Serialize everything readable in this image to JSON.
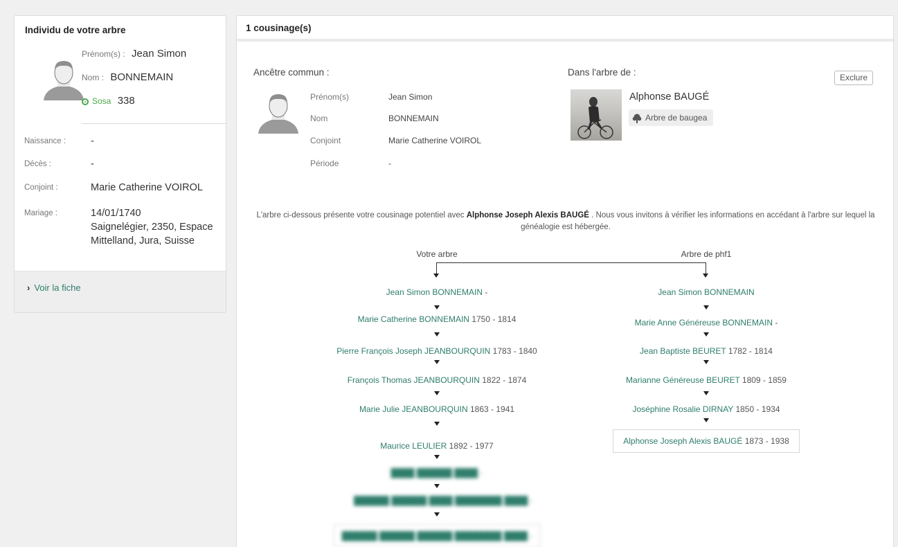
{
  "left": {
    "title": "Individu de votre arbre",
    "prenom_label": "Prénom(s) :",
    "prenom": "Jean Simon",
    "nom_label": "Nom :",
    "nom": "BONNEMAIN",
    "sosa_label": "Sosa",
    "sosa": "338",
    "naissance_label": "Naissance :",
    "naissance": "-",
    "deces_label": "Décès :",
    "deces": "-",
    "conjoint_label": "Conjoint :",
    "conjoint": "Marie Catherine VOIROL",
    "mariage_label": "Mariage :",
    "mariage_date": "14/01/1740",
    "mariage_lieu": "Saignelégier, 2350, Espace Mittelland, Jura, Suisse",
    "voir_fiche": "Voir la fiche"
  },
  "right": {
    "title": "1 cousinage(s)",
    "ancetre_label": "Ancêtre commun :",
    "ancetre": {
      "prenom_label": "Prénom(s)",
      "prenom": "Jean Simon",
      "nom_label": "Nom",
      "nom": "BONNEMAIN",
      "conjoint_label": "Conjoint",
      "conjoint": "Marie Catherine VOIROL",
      "periode_label": "Période",
      "periode": "-"
    },
    "dans_arbre_label": "Dans l'arbre de :",
    "exclure": "Exclure",
    "person_name": "Alphonse BAUGÉ",
    "tree_button": "Arbre de baugea",
    "intro_part1": "L'arbre ci-dessous présente votre cousinage potentiel avec ",
    "intro_bold": "Alphonse Joseph Alexis BAUGÉ",
    "intro_part2": " . Nous vous invitons à vérifier les informations en accédant à l'arbre sur lequel la généalogie est hébergée.",
    "col_left_head": "Votre arbre",
    "col_right_head": "Arbre de phf1",
    "left_chain": [
      {
        "name": "Jean Simon BONNEMAIN",
        "dates": "-"
      },
      {
        "name": "Marie Catherine BONNEMAIN",
        "dates": "1750 - 1814"
      },
      {
        "name": "Pierre François Joseph JEANBOURQUIN",
        "dates": "1783 - 1840"
      },
      {
        "name": "François Thomas JEANBOURQUIN",
        "dates": "1822 - 1874"
      },
      {
        "name": "Marie Julie JEANBOURQUIN",
        "dates": "1863 - 1941"
      },
      {
        "name": "Maurice LEULIER",
        "dates": "1892 - 1977"
      }
    ],
    "right_chain": [
      {
        "name": "Jean Simon BONNEMAIN",
        "dates": ""
      },
      {
        "name": "Marie Anne Généreuse BONNEMAIN",
        "dates": "-"
      },
      {
        "name": "Jean Baptiste BEURET",
        "dates": "1782 - 1814"
      },
      {
        "name": "Marianne Généreuse BEURET",
        "dates": "1809 - 1859"
      },
      {
        "name": "Joséphine Rosalie DIRNAY",
        "dates": "1850 - 1934"
      },
      {
        "name": "Alphonse Joseph Alexis BAUGÉ",
        "dates": "1873 - 1938"
      }
    ]
  },
  "colors": {
    "link": "#2e7d6b",
    "sosa": "#4aa84a",
    "panel_bg": "#ffffff",
    "page_bg": "#f0f0f0"
  },
  "icons": [
    "person-avatar-icon",
    "sosa-radio-icon",
    "chevron-right-icon",
    "tree-icon",
    "arrow-down-icon"
  ]
}
